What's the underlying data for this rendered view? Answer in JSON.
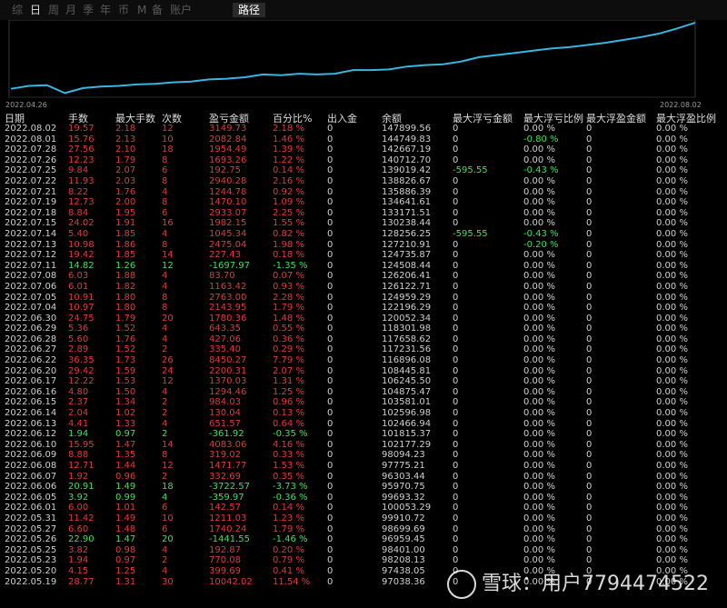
{
  "tabs": [
    "综",
    "日",
    "周",
    "月",
    "季",
    "年",
    "币",
    "M",
    "备",
    "账户"
  ],
  "active_tab": 1,
  "route_tab": "路径",
  "chart_data": {
    "type": "line",
    "x_start": "2022.04.26",
    "x_end": "2022.08.02",
    "series_points": [
      0.08,
      0.12,
      0.13,
      0.02,
      0.09,
      0.11,
      0.12,
      0.14,
      0.15,
      0.17,
      0.18,
      0.21,
      0.22,
      0.24,
      0.28,
      0.27,
      0.29,
      0.28,
      0.29,
      0.34,
      0.34,
      0.35,
      0.39,
      0.41,
      0.42,
      0.46,
      0.52,
      0.55,
      0.58,
      0.61,
      0.64,
      0.66,
      0.69,
      0.72,
      0.76,
      0.8,
      0.85,
      0.92,
      1.0
    ],
    "line_color": "#3ab4e0"
  },
  "headers": [
    "日期",
    "手数",
    "最大手数",
    "次数",
    "盈亏金额",
    "百分比%",
    "出入金",
    "余额",
    "最大浮亏金额",
    "最大浮亏比例",
    "最大浮盈金额",
    "最大浮盈比例"
  ],
  "rows": [
    [
      "2022.08.02",
      "19.57",
      "2.18",
      "12",
      "3149.73",
      "2.18 %",
      "0",
      "147899.56",
      "0",
      "0.00 %",
      "0",
      "0.00 %",
      "r"
    ],
    [
      "2022.08.01",
      "15.76",
      "2.13",
      "10",
      "2082.84",
      "1.46 %",
      "0",
      "144749.83",
      "0",
      "-0.80 %",
      "0",
      "0.00 %",
      "r"
    ],
    [
      "2022.07.28",
      "27.56",
      "2.10",
      "18",
      "1954.49",
      "1.39 %",
      "0",
      "142667.19",
      "0",
      "0.00 %",
      "0",
      "0.00 %",
      "r"
    ],
    [
      "2022.07.26",
      "12.23",
      "1.79",
      "8",
      "1693.26",
      "1.22 %",
      "0",
      "140712.70",
      "0",
      "0.00 %",
      "0",
      "0.00 %",
      "r"
    ],
    [
      "2022.07.25",
      "9.84",
      "2.07",
      "6",
      "192.75",
      "0.14 %",
      "0",
      "139019.42",
      "-595.55",
      "-0.43 %",
      "0",
      "0.00 %",
      "r"
    ],
    [
      "2022.07.22",
      "11.93",
      "2.03",
      "8",
      "2940.28",
      "2.16 %",
      "0",
      "138826.67",
      "0",
      "0.00 %",
      "0",
      "0.00 %",
      "r"
    ],
    [
      "2022.07.21",
      "8.22",
      "1.76",
      "4",
      "1244.78",
      "0.92 %",
      "0",
      "135886.39",
      "0",
      "0.00 %",
      "0",
      "0.00 %",
      "r"
    ],
    [
      "2022.07.19",
      "12.73",
      "2.00",
      "8",
      "1470.10",
      "1.09 %",
      "0",
      "134641.61",
      "0",
      "0.00 %",
      "0",
      "0.00 %",
      "r"
    ],
    [
      "2022.07.18",
      "8.84",
      "1.95",
      "6",
      "2933.07",
      "2.25 %",
      "0",
      "133171.51",
      "0",
      "0.00 %",
      "0",
      "0.00 %",
      "r"
    ],
    [
      "2022.07.15",
      "24.02",
      "1.91",
      "16",
      "1982.15",
      "1.55 %",
      "0",
      "130238.44",
      "0",
      "0.00 %",
      "0",
      "0.00 %",
      "r"
    ],
    [
      "2022.07.14",
      "5.40",
      "1.85",
      "4",
      "1045.34",
      "0.82 %",
      "0",
      "128256.25",
      "-595.55",
      "-0.43 %",
      "0",
      "0.00 %",
      "r"
    ],
    [
      "2022.07.13",
      "10.98",
      "1.86",
      "8",
      "2475.04",
      "1.98 %",
      "0",
      "127210.91",
      "0",
      "-0.20 %",
      "0",
      "0.00 %",
      "r"
    ],
    [
      "2022.07.12",
      "19.42",
      "1.85",
      "14",
      "227.43",
      "0.18 %",
      "0",
      "124735.87",
      "0",
      "0.00 %",
      "0",
      "0.00 %",
      "r"
    ],
    [
      "2022.07.11",
      "14.82",
      "1.26",
      "12",
      "-1697.97",
      "-1.35 %",
      "0",
      "124508.44",
      "0",
      "0.00 %",
      "0",
      "0.00 %",
      "g"
    ],
    [
      "2022.07.08",
      "6.03",
      "1.88",
      "4",
      "83.70",
      "0.07 %",
      "0",
      "126206.41",
      "0",
      "0.00 %",
      "0",
      "0.00 %",
      "r"
    ],
    [
      "2022.07.06",
      "6.01",
      "1.82",
      "4",
      "1163.42",
      "0.93 %",
      "0",
      "126122.71",
      "0",
      "0.00 %",
      "0",
      "0.00 %",
      "r"
    ],
    [
      "2022.07.05",
      "10.91",
      "1.80",
      "8",
      "2763.00",
      "2.28 %",
      "0",
      "124959.29",
      "0",
      "0.00 %",
      "0",
      "0.00 %",
      "r"
    ],
    [
      "2022.07.04",
      "10.97",
      "1.80",
      "8",
      "2143.95",
      "1.79 %",
      "0",
      "122196.29",
      "0",
      "0.00 %",
      "0",
      "0.00 %",
      "r"
    ],
    [
      "2022.06.30",
      "24.75",
      "1.79",
      "20",
      "1780.36",
      "1.48 %",
      "0",
      "120052.34",
      "0",
      "0.00 %",
      "0",
      "0.00 %",
      "r"
    ],
    [
      "2022.06.29",
      "5.36",
      "1.52",
      "4",
      "643.35",
      "0.55 %",
      "0",
      "118301.98",
      "0",
      "0.00 %",
      "0",
      "0.00 %",
      "r"
    ],
    [
      "2022.06.28",
      "5.60",
      "1.76",
      "4",
      "427.06",
      "0.36 %",
      "0",
      "117658.62",
      "0",
      "0.00 %",
      "0",
      "0.00 %",
      "r"
    ],
    [
      "2022.06.27",
      "2.89",
      "1.52",
      "2",
      "335.40",
      "0.29 %",
      "0",
      "117231.56",
      "0",
      "0.00 %",
      "0",
      "0.00 %",
      "r"
    ],
    [
      "2022.06.22",
      "36.35",
      "1.73",
      "26",
      "8450.27",
      "7.79 %",
      "0",
      "116896.08",
      "0",
      "0.00 %",
      "0",
      "0.00 %",
      "r"
    ],
    [
      "2022.06.20",
      "29.42",
      "1.59",
      "24",
      "2200.31",
      "2.07 %",
      "0",
      "108445.81",
      "0",
      "0.00 %",
      "0",
      "0.00 %",
      "r"
    ],
    [
      "2022.06.17",
      "12.22",
      "1.53",
      "12",
      "1370.03",
      "1.31 %",
      "0",
      "106245.50",
      "0",
      "0.00 %",
      "0",
      "0.00 %",
      "r"
    ],
    [
      "2022.06.16",
      "4.80",
      "1.50",
      "4",
      "1294.46",
      "1.25 %",
      "0",
      "104875.47",
      "0",
      "0.00 %",
      "0",
      "0.00 %",
      "r"
    ],
    [
      "2022.06.15",
      "2.37",
      "1.34",
      "2",
      "984.03",
      "0.96 %",
      "0",
      "103581.01",
      "0",
      "0.00 %",
      "0",
      "0.00 %",
      "r"
    ],
    [
      "2022.06.14",
      "2.04",
      "1.02",
      "2",
      "130.04",
      "0.13 %",
      "0",
      "102596.98",
      "0",
      "0.00 %",
      "0",
      "0.00 %",
      "r"
    ],
    [
      "2022.06.13",
      "4.41",
      "1.33",
      "4",
      "651.57",
      "0.64 %",
      "0",
      "102466.94",
      "0",
      "0.00 %",
      "0",
      "0.00 %",
      "r"
    ],
    [
      "2022.06.12",
      "1.94",
      "0.97",
      "2",
      "-361.92",
      "-0.35 %",
      "0",
      "101815.37",
      "0",
      "0.00 %",
      "0",
      "0.00 %",
      "g"
    ],
    [
      "2022.06.10",
      "15.95",
      "1.47",
      "14",
      "4083.06",
      "4.16 %",
      "0",
      "102177.29",
      "0",
      "0.00 %",
      "0",
      "0.00 %",
      "r"
    ],
    [
      "2022.06.09",
      "8.88",
      "1.35",
      "8",
      "319.02",
      "0.33 %",
      "0",
      "98094.23",
      "0",
      "0.00 %",
      "0",
      "0.00 %",
      "r"
    ],
    [
      "2022.06.08",
      "12.71",
      "1.44",
      "12",
      "1471.77",
      "1.53 %",
      "0",
      "97775.21",
      "0",
      "0.00 %",
      "0",
      "0.00 %",
      "r"
    ],
    [
      "2022.06.07",
      "1.92",
      "0.96",
      "2",
      "332.69",
      "0.35 %",
      "0",
      "96303.44",
      "0",
      "0.00 %",
      "0",
      "0.00 %",
      "r"
    ],
    [
      "2022.06.06",
      "20.91",
      "1.49",
      "18",
      "-3722.57",
      "-3.73 %",
      "0",
      "95970.75",
      "0",
      "0.00 %",
      "0",
      "0.00 %",
      "g"
    ],
    [
      "2022.06.05",
      "3.92",
      "0.99",
      "4",
      "-359.97",
      "-0.36 %",
      "0",
      "99693.32",
      "0",
      "0.00 %",
      "0",
      "0.00 %",
      "g"
    ],
    [
      "2022.06.01",
      "6.00",
      "1.01",
      "6",
      "142.57",
      "0.14 %",
      "0",
      "100053.29",
      "0",
      "0.00 %",
      "0",
      "0.00 %",
      "r"
    ],
    [
      "2022.05.31",
      "11.42",
      "1.49",
      "10",
      "1211.03",
      "1.23 %",
      "0",
      "99910.72",
      "0",
      "0.00 %",
      "0",
      "0.00 %",
      "r"
    ],
    [
      "2022.05.27",
      "6.60",
      "1.48",
      "6",
      "1740.24",
      "1.79 %",
      "0",
      "98699.69",
      "0",
      "0.00 %",
      "0",
      "0.00 %",
      "r"
    ],
    [
      "2022.05.26",
      "22.90",
      "1.47",
      "20",
      "-1441.55",
      "-1.46 %",
      "0",
      "96959.45",
      "0",
      "0.00 %",
      "0",
      "0.00 %",
      "g"
    ],
    [
      "2022.05.25",
      "3.82",
      "0.98",
      "4",
      "192.87",
      "0.20 %",
      "0",
      "98401.00",
      "0",
      "0.00 %",
      "0",
      "0.00 %",
      "r"
    ],
    [
      "2022.05.23",
      "1.94",
      "0.97",
      "2",
      "770.08",
      "0.79 %",
      "0",
      "98208.13",
      "0",
      "0.00 %",
      "0",
      "0.00 %",
      "r"
    ],
    [
      "2022.05.20",
      "4.15",
      "1.25",
      "4",
      "399.69",
      "0.41 %",
      "0",
      "97438.05",
      "0",
      "0.00 %",
      "0",
      "0.00 %",
      "r"
    ],
    [
      "2022.05.19",
      "28.77",
      "1.31",
      "30",
      "10042.02",
      "11.54 %",
      "0",
      "97038.36",
      "0",
      "0.00 %",
      "0",
      "0.00 %",
      "r"
    ]
  ],
  "watermark": "雪球：用户7794474522"
}
